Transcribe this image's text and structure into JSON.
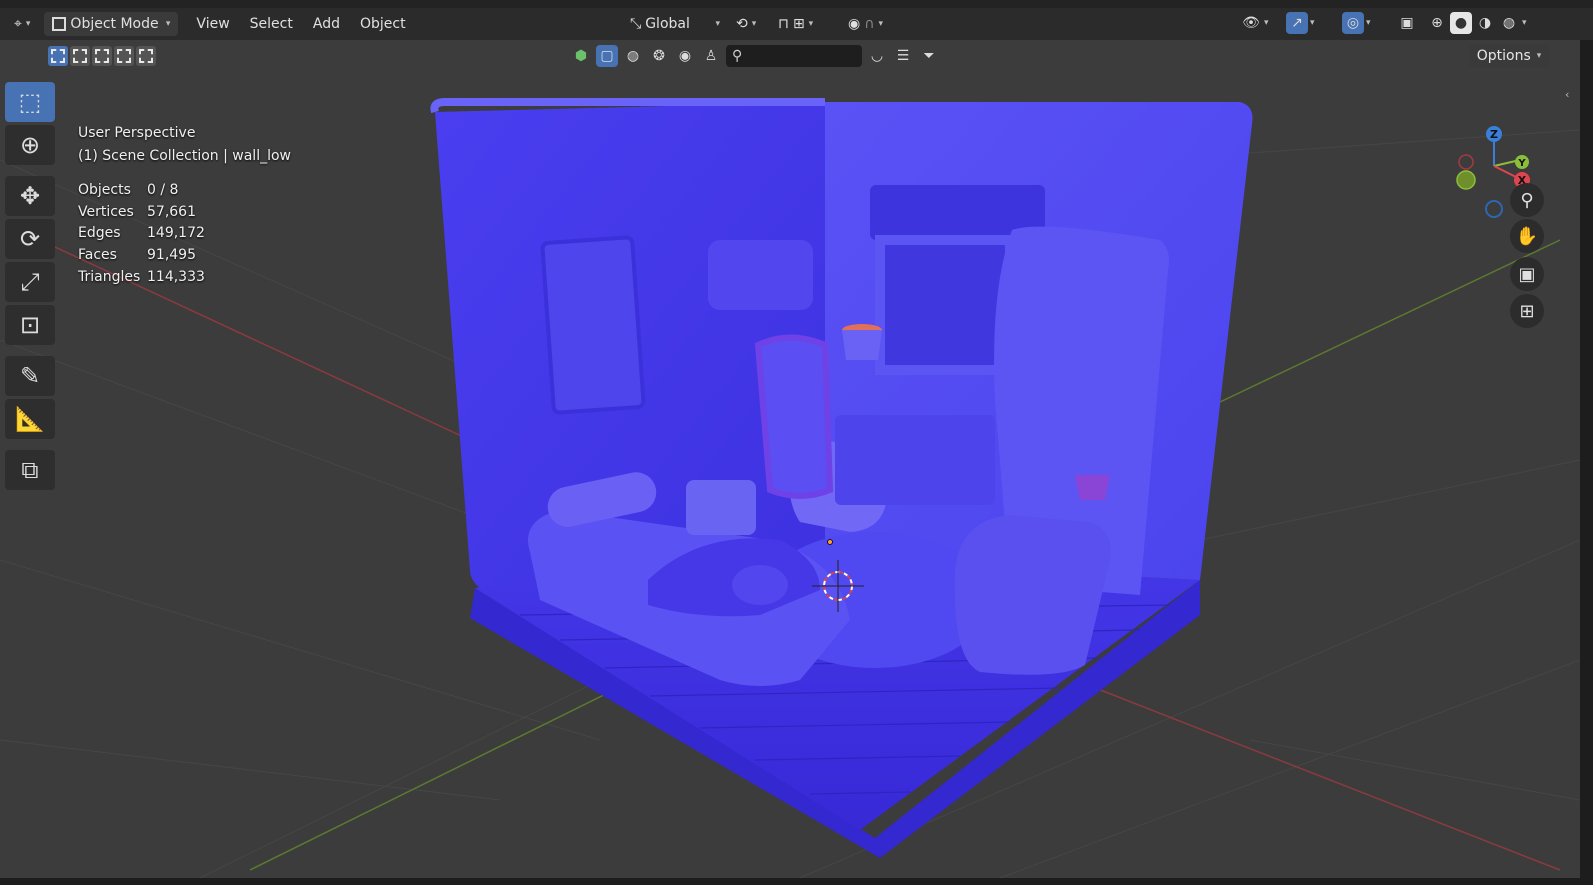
{
  "header": {
    "editor_icon": "3d-viewport-icon",
    "mode_label": "Object Mode",
    "menus": [
      "View",
      "Select",
      "Add",
      "Object"
    ],
    "orientation_label": "Global"
  },
  "subbar": {
    "options_label": "Options"
  },
  "viewport": {
    "view_name": "User Perspective",
    "collection_line": "(1) Scene Collection | wall_low",
    "stats": [
      {
        "label": "Objects",
        "value": "0 / 8"
      },
      {
        "label": "Vertices",
        "value": "57,661"
      },
      {
        "label": "Edges",
        "value": "149,172"
      },
      {
        "label": "Faces",
        "value": "91,495"
      },
      {
        "label": "Triangles",
        "value": "114,333"
      }
    ]
  },
  "gizmo": {
    "x_label": "X",
    "y_label": "Y",
    "z_label": "Z"
  },
  "colors": {
    "accent": "#4772b3",
    "model": "#4a3ef2",
    "background": "#3c3c3c",
    "x_axis": "#e0454f",
    "y_axis": "#8bbf3a",
    "z_axis": "#3a7fd9"
  },
  "icons": {
    "tools": [
      "select-box-icon",
      "cursor-icon",
      "move-icon",
      "rotate-icon",
      "scale-icon",
      "transform-icon",
      "annotate-icon",
      "measure-icon",
      "add-cube-icon"
    ],
    "nav": [
      "zoom-icon",
      "pan-hand-icon",
      "camera-icon",
      "ortho-grid-icon"
    ]
  }
}
